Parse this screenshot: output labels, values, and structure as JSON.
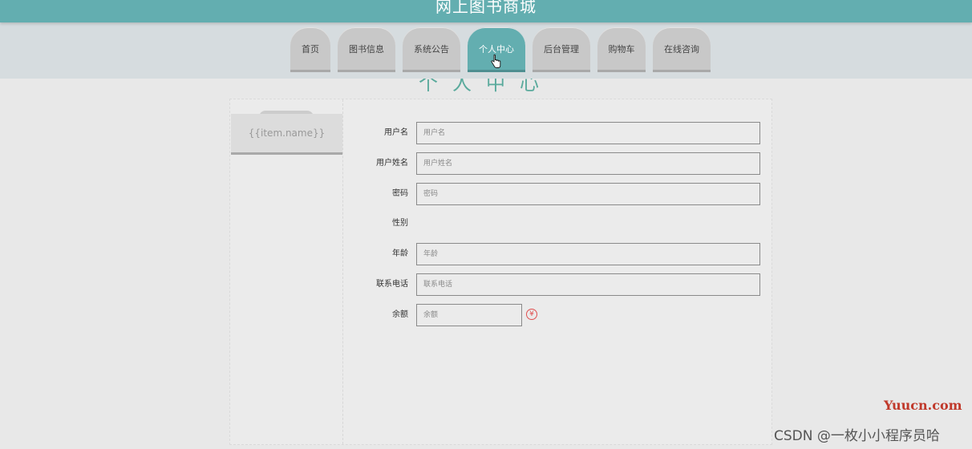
{
  "header": {
    "site_title": "网上图书商城"
  },
  "nav": {
    "tabs": [
      {
        "label": "首页"
      },
      {
        "label": "图书信息"
      },
      {
        "label": "系统公告"
      },
      {
        "label": "个人中心",
        "active": true
      },
      {
        "label": "后台管理"
      },
      {
        "label": "购物车"
      },
      {
        "label": "在线咨询"
      }
    ]
  },
  "page": {
    "heading": "个人中心"
  },
  "sidebar": {
    "item_label": "{{item.name}}"
  },
  "form": {
    "username": {
      "label": "用户名",
      "placeholder": "用户名"
    },
    "real_name": {
      "label": "用户姓名",
      "placeholder": "用户姓名"
    },
    "password": {
      "label": "密码",
      "placeholder": "密码"
    },
    "gender": {
      "label": "性别"
    },
    "age": {
      "label": "年龄",
      "placeholder": "年龄"
    },
    "phone": {
      "label": "联系电话",
      "placeholder": "联系电话"
    },
    "balance": {
      "label": "余额",
      "placeholder": "余额",
      "currency_symbol": "¥"
    }
  },
  "watermarks": {
    "yuucn": "Yuucn.com",
    "csdn": "CSDN @一枚小小程序员哈"
  },
  "colors": {
    "brand": "#63aeb0",
    "background": "#e8e8e8",
    "heading_green": "#5aaa9c",
    "currency_red": "#e05050"
  },
  "icons": {
    "cursor": "hand-pointer-icon",
    "currency": "yen-icon"
  }
}
